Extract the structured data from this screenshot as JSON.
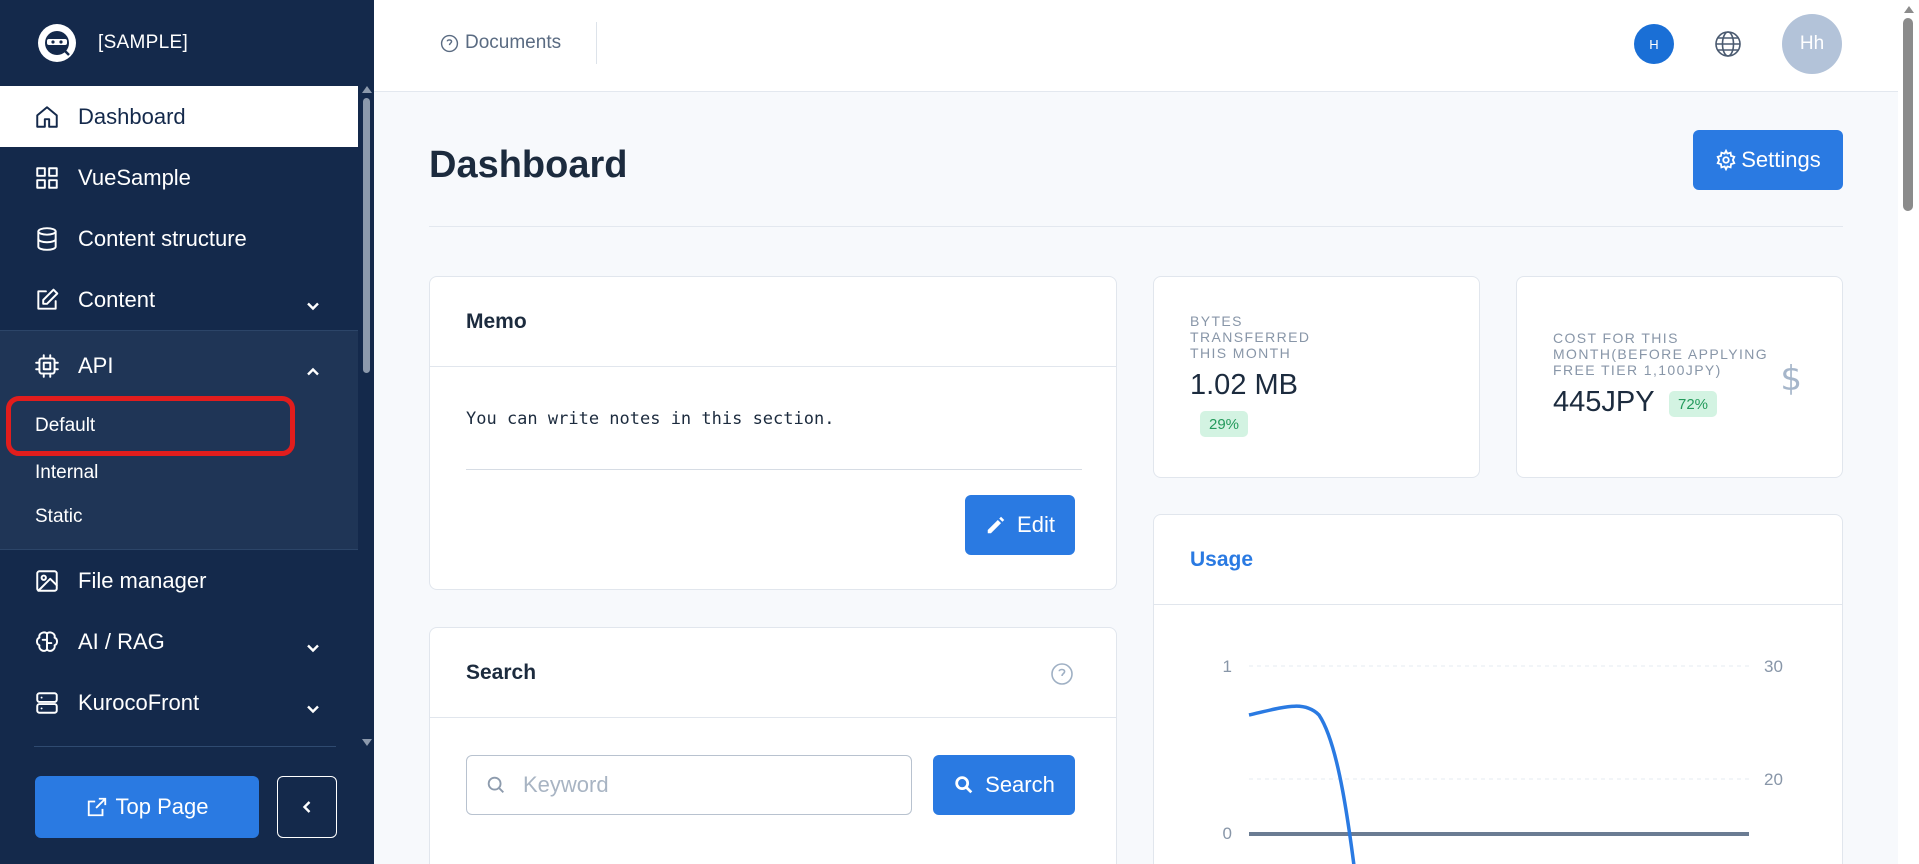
{
  "brand": {
    "name": "[SAMPLE]"
  },
  "sidebar": {
    "items": [
      {
        "label": "Dashboard",
        "icon": "home-icon"
      },
      {
        "label": "VueSample",
        "icon": "grid-icon"
      },
      {
        "label": "Content structure",
        "icon": "database-icon"
      },
      {
        "label": "Content",
        "icon": "edit-icon"
      },
      {
        "label": "API",
        "icon": "chip-icon"
      },
      {
        "label": "File manager",
        "icon": "image-icon"
      },
      {
        "label": "AI / RAG",
        "icon": "brain-icon"
      },
      {
        "label": "KurocoFront",
        "icon": "server-icon"
      }
    ],
    "api_sub": [
      "Default",
      "Internal",
      "Static"
    ],
    "top_page_label": "Top Page"
  },
  "topbar": {
    "documents_label": "Documents",
    "badge_label": "H",
    "avatar_initials": "Hh"
  },
  "page": {
    "title": "Dashboard",
    "settings_label": "Settings"
  },
  "memo": {
    "title": "Memo",
    "body": "You can write notes in this section.",
    "edit_label": "Edit"
  },
  "search": {
    "title": "Search",
    "placeholder": "Keyword",
    "button_label": "Search"
  },
  "stats": {
    "bytes": {
      "label_lines": [
        "BYTES",
        "TRANSFERRED",
        "THIS MONTH"
      ],
      "value": "1.02 MB",
      "percent": "29%"
    },
    "cost": {
      "label_lines": [
        "COST FOR THIS",
        "MONTH(BEFORE APPLYING",
        "FREE TIER 1,100JPY)"
      ],
      "value": "445JPY",
      "percent": "72%"
    }
  },
  "usage": {
    "title": "Usage"
  },
  "chart_data": {
    "type": "line",
    "title": "",
    "y_left_ticks": [
      "1",
      "0"
    ],
    "y_right_ticks": [
      "30",
      "20"
    ],
    "colors": {
      "line": "#2a7ae2",
      "baseline": "#6b7c93"
    }
  },
  "colors": {
    "sidebar_bg": "#14294b",
    "accent": "#2a7ae2",
    "highlight": "#e11d1d"
  }
}
